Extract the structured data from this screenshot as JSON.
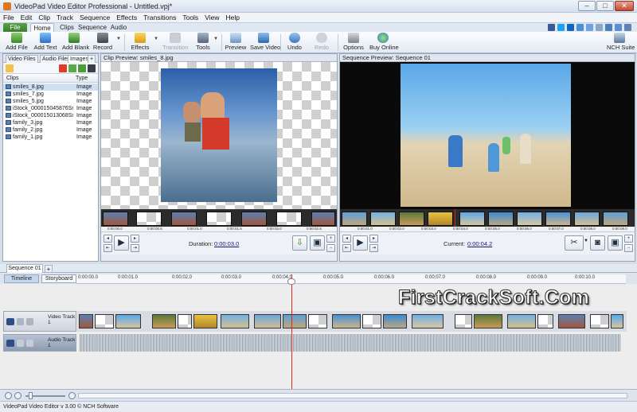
{
  "window": {
    "title": "VideoPad Video Editor Professional - Untitled.vpj*",
    "min": "–",
    "max": "□",
    "close": "✕"
  },
  "menu": [
    "File",
    "Edit",
    "Clip",
    "Track",
    "Sequence",
    "Effects",
    "Transitions",
    "Tools",
    "View",
    "Help"
  ],
  "ribbon_tabs": {
    "file": "File",
    "home": "Home",
    "clips": "Clips",
    "sequence": "Sequence",
    "audio": "Audio"
  },
  "toolbar": {
    "add_file": "Add File",
    "add_text": "Add Text",
    "add_blank": "Add Blank",
    "record": "Record",
    "effects": "Effects",
    "transition": "Transition",
    "tools": "Tools",
    "preview": "Preview",
    "save_video": "Save Video",
    "undo": "Undo",
    "redo": "Redo",
    "options": "Options",
    "buy_online": "Buy Online",
    "nch_suite": "NCH Suite"
  },
  "bin": {
    "tabs": [
      "Video Files",
      "Audio Files",
      "Images"
    ],
    "add_tab": "+",
    "columns": {
      "name": "Clips",
      "type": "Type"
    },
    "items": [
      {
        "name": "smiles_8.jpg",
        "type": "Image"
      },
      {
        "name": "smiles_7.jpg",
        "type": "Image"
      },
      {
        "name": "smiles_5.jpg",
        "type": "Image"
      },
      {
        "name": "iStock_000015045876Sm...",
        "type": "Image"
      },
      {
        "name": "iStock_000015013068Sm...",
        "type": "Image"
      },
      {
        "name": "family_3.jpg",
        "type": "Image"
      },
      {
        "name": "family_2.jpg",
        "type": "Image"
      },
      {
        "name": "family_1.jpg",
        "type": "Image"
      }
    ]
  },
  "clip_preview": {
    "title": "Clip Preview: smiles_8.jpg",
    "duration_label": "Duration:",
    "duration_value": "0:00:03.0",
    "ticks": [
      "0:00:00.0",
      "0:00:00.5",
      "0:00:01.0",
      "0:00:01.5",
      "0:00:02.0",
      "0:00:02.5"
    ]
  },
  "sequence_preview": {
    "title": "Sequence Preview: Sequence 01",
    "current_label": "Current:",
    "current_value": "0:00:04.2",
    "ticks": [
      "0:00:01.0",
      "0:00:02.0",
      "0:00:03.0",
      "0:00:04.0",
      "0:00:05.0",
      "0:00:06.0",
      "0:00:07.0",
      "0:00:08.0",
      "0:00:09.0"
    ]
  },
  "sequence_tabs": {
    "active": "Sequence 01",
    "add": "+"
  },
  "timeline": {
    "view_timeline": "Timeline",
    "view_storyboard": "Storyboard",
    "ruler": [
      "0:00:00.0",
      "0:00:01.0",
      "0:00:02.0",
      "0:00:03.0",
      "0:00:04.0",
      "0:00:05.0",
      "0:00:06.0",
      "0:00:07.0",
      "0:00:08.0",
      "0:00:09.0",
      "0:00:10.0"
    ],
    "video_track": "Video Track 1",
    "audio_track": "Audio Track 1"
  },
  "watermark": "FirstCrackSoft.Com",
  "status": "VideoPad Video Editor v 3.00 © NCH Software",
  "colors": {
    "accent": "#3b7e2e",
    "chrome": "#d8dee8",
    "playhead": "#d8291e"
  }
}
